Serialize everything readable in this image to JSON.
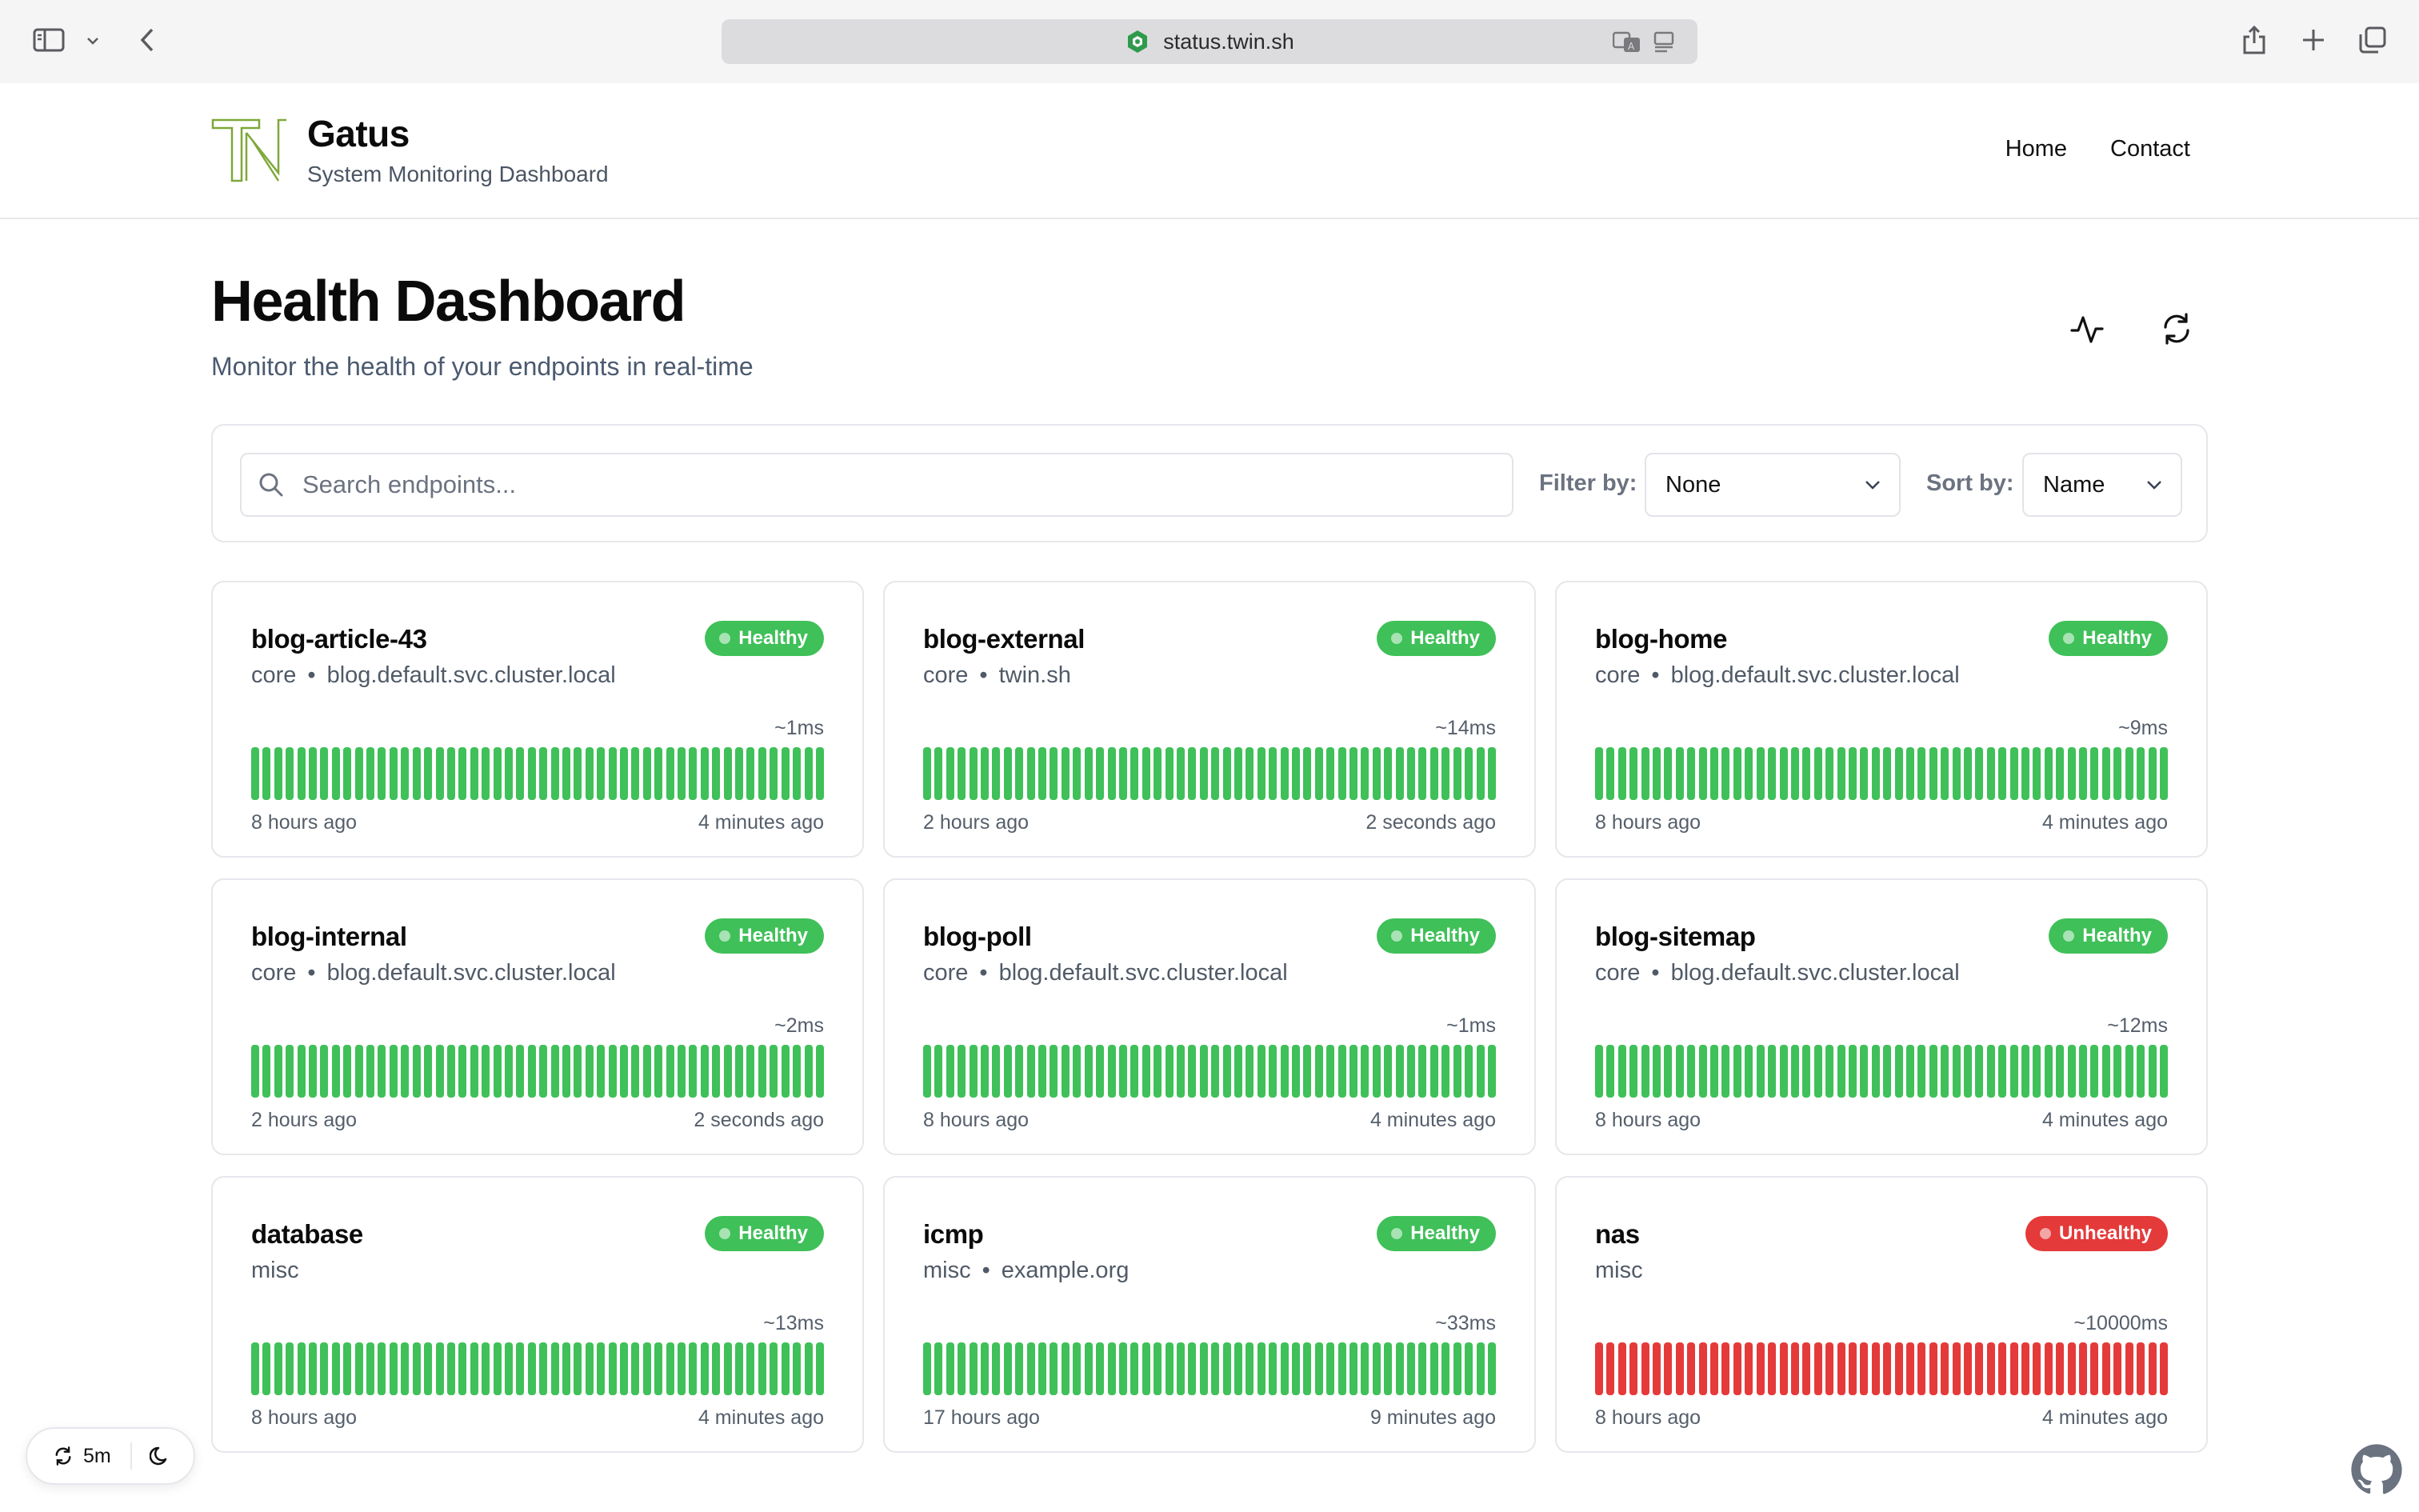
{
  "browser": {
    "url": "status.twin.sh"
  },
  "header": {
    "brand_title": "Gatus",
    "brand_subtitle": "System Monitoring Dashboard",
    "nav": [
      "Home",
      "Contact"
    ]
  },
  "main": {
    "title": "Health Dashboard",
    "subtitle": "Monitor the health of your endpoints in real-time"
  },
  "filters": {
    "search_placeholder": "Search endpoints...",
    "filter_label": "Filter by:",
    "filter_value": "None",
    "sort_label": "Sort by:",
    "sort_value": "Name"
  },
  "colors": {
    "healthy": "#3fc059",
    "unhealthy": "#e53a3a"
  },
  "endpoints": [
    {
      "name": "blog-article-43",
      "group": "core",
      "host": "blog.default.svc.cluster.local",
      "status": "Healthy",
      "response": "~1ms",
      "oldest": "8 hours ago",
      "newest": "4 minutes ago"
    },
    {
      "name": "blog-external",
      "group": "core",
      "host": "twin.sh",
      "status": "Healthy",
      "response": "~14ms",
      "oldest": "2 hours ago",
      "newest": "2 seconds ago"
    },
    {
      "name": "blog-home",
      "group": "core",
      "host": "blog.default.svc.cluster.local",
      "status": "Healthy",
      "response": "~9ms",
      "oldest": "8 hours ago",
      "newest": "4 minutes ago"
    },
    {
      "name": "blog-internal",
      "group": "core",
      "host": "blog.default.svc.cluster.local",
      "status": "Healthy",
      "response": "~2ms",
      "oldest": "2 hours ago",
      "newest": "2 seconds ago"
    },
    {
      "name": "blog-poll",
      "group": "core",
      "host": "blog.default.svc.cluster.local",
      "status": "Healthy",
      "response": "~1ms",
      "oldest": "8 hours ago",
      "newest": "4 minutes ago"
    },
    {
      "name": "blog-sitemap",
      "group": "core",
      "host": "blog.default.svc.cluster.local",
      "status": "Healthy",
      "response": "~12ms",
      "oldest": "8 hours ago",
      "newest": "4 minutes ago"
    },
    {
      "name": "database",
      "group": "misc",
      "host": "",
      "status": "Healthy",
      "response": "~13ms",
      "oldest": "8 hours ago",
      "newest": "4 minutes ago"
    },
    {
      "name": "icmp",
      "group": "misc",
      "host": "example.org",
      "status": "Healthy",
      "response": "~33ms",
      "oldest": "17 hours ago",
      "newest": "9 minutes ago"
    },
    {
      "name": "nas",
      "group": "misc",
      "host": "",
      "status": "Unhealthy",
      "response": "~10000ms",
      "oldest": "8 hours ago",
      "newest": "4 minutes ago"
    }
  ],
  "bottom": {
    "refresh_interval": "5m"
  }
}
